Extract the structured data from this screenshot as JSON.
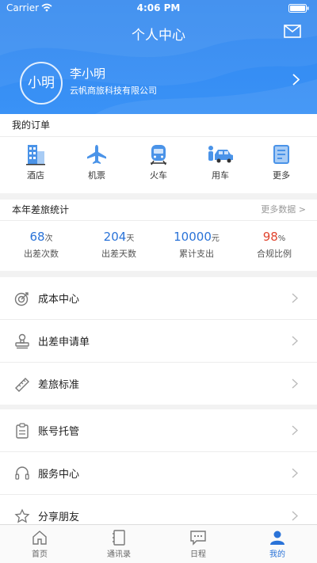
{
  "status_bar": {
    "carrier": "Carrier",
    "time": "4:06 PM"
  },
  "header": {
    "title": "个人中心",
    "mail_icon": "mail-icon"
  },
  "user": {
    "avatar_text": "小明",
    "name": "李小明",
    "company": "云帆商旅科技有限公司"
  },
  "orders": {
    "title": "我的订单",
    "items": [
      {
        "label": "酒店",
        "icon": "hotel-icon"
      },
      {
        "label": "机票",
        "icon": "airplane-icon"
      },
      {
        "label": "火车",
        "icon": "train-icon"
      },
      {
        "label": "用车",
        "icon": "car-icon"
      },
      {
        "label": "更多",
        "icon": "more-icon"
      }
    ]
  },
  "stats": {
    "title": "本年差旅统计",
    "more_label": "更多数据 >",
    "items": [
      {
        "value": "68",
        "unit": "次",
        "label": "出差次数"
      },
      {
        "value": "204",
        "unit": "天",
        "label": "出差天数"
      },
      {
        "value": "10000",
        "unit": "元",
        "label": "累计支出"
      },
      {
        "value": "98",
        "unit": "%",
        "label": "合规比例"
      }
    ]
  },
  "menu_group_1": [
    {
      "label": "成本中心",
      "icon": "target-icon"
    },
    {
      "label": "出差申请单",
      "icon": "stamp-icon"
    },
    {
      "label": "差旅标准",
      "icon": "ruler-icon"
    }
  ],
  "menu_group_2": [
    {
      "label": "账号托管",
      "icon": "clipboard-icon"
    },
    {
      "label": "服务中心",
      "icon": "headset-icon"
    },
    {
      "label": "分享朋友",
      "icon": "star-icon"
    }
  ],
  "tabbar": {
    "items": [
      {
        "label": "首页",
        "icon": "home-icon"
      },
      {
        "label": "通讯录",
        "icon": "contacts-icon"
      },
      {
        "label": "日程",
        "icon": "chat-icon"
      },
      {
        "label": "我的",
        "icon": "person-icon"
      }
    ],
    "active_index": 3
  },
  "colors": {
    "primary": "#3a8ef5",
    "accent_red": "#e0452f",
    "stat_blue": "#2a73d8"
  }
}
